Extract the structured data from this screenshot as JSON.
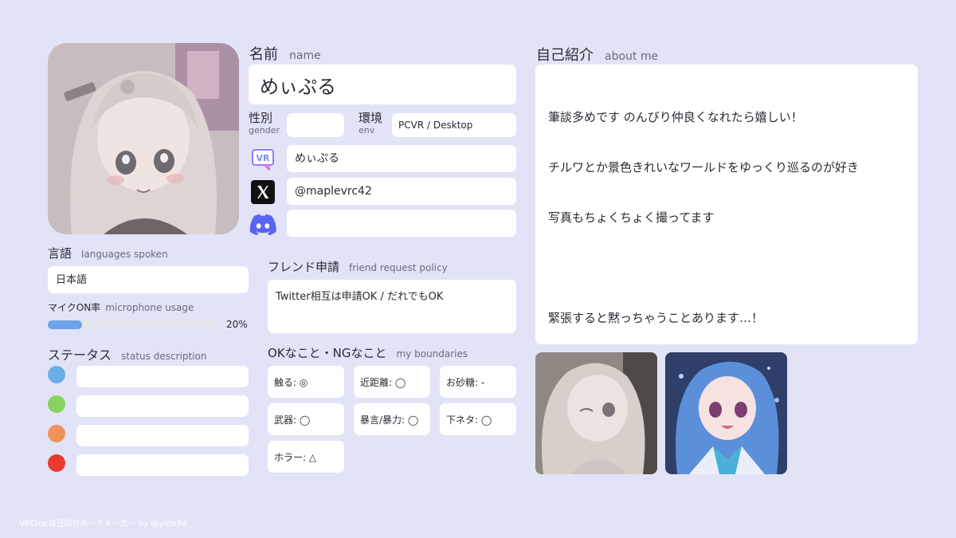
{
  "name": {
    "label_jp": "名前",
    "label_en": "name",
    "value": "めぃぷる"
  },
  "gender": {
    "label_jp": "性別",
    "label_en": "gender",
    "value": ""
  },
  "env": {
    "label_jp": "環境",
    "label_en": "env",
    "value": "PCVR / Desktop"
  },
  "accounts": {
    "vrchat": {
      "icon": "vrchat-icon",
      "value": "めぃぷる"
    },
    "x": {
      "icon": "x-logo-icon",
      "value": "@maplevrc42"
    },
    "discord": {
      "icon": "discord-icon",
      "value": ""
    }
  },
  "languages": {
    "label_jp": "言語",
    "label_en": "languages spoken",
    "value": "日本語"
  },
  "mic": {
    "label_jp": "マイクON率",
    "label_en": "microphone usage",
    "percent": 20,
    "percent_text": "20%"
  },
  "status": {
    "label_jp": "ステータス",
    "label_en": "status description",
    "items": [
      {
        "color": "#6aaee8",
        "text": ""
      },
      {
        "color": "#86d35f",
        "text": ""
      },
      {
        "color": "#ef9358",
        "text": ""
      },
      {
        "color": "#e63b2e",
        "text": ""
      }
    ]
  },
  "friend": {
    "label_jp": "フレンド申請",
    "label_en": "friend request policy",
    "value": "Twitter相互は申請OK / だれでもOK"
  },
  "boundaries": {
    "label_jp": "OKなこと・NGなこと",
    "label_en": "my boundaries",
    "items": [
      "触る: ◎",
      "近距離: ◯",
      "お砂糖: -",
      "武器: ◯",
      "暴言/暴力: ◯",
      "下ネタ: ◯",
      "ホラー: △"
    ]
  },
  "about": {
    "label_jp": "自己紹介",
    "label_en": "about me",
    "lines": [
      "筆談多めです のんびり仲良くなれたら嬉しい！",
      "チルワとか景色きれいなワールドをゆっくり巡るのが好き",
      "写真もちょくちょく撮ってます",
      "",
      "緊張すると黙っちゃうことあります…！"
    ]
  },
  "footer": "VRChat自己紹介カードメーカー by @yota3d",
  "colors": {
    "background": "#e3e3f7",
    "mic_bar": "#6fa3ea",
    "mic_track": "#e6e6ee"
  }
}
